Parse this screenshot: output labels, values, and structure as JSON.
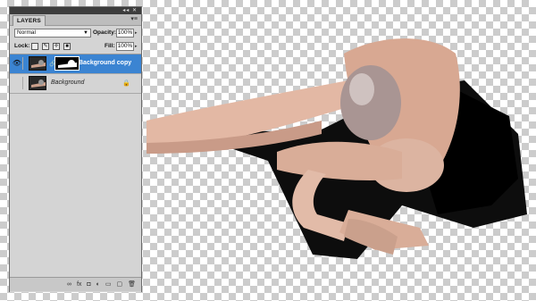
{
  "panel": {
    "tab_label": "LAYERS",
    "blend_mode": "Normal",
    "opacity_label": "Opacity:",
    "opacity_value": "100%",
    "lock_label": "Lock:",
    "fill_label": "Fill:",
    "fill_value": "100%",
    "layers": [
      {
        "name": "Background copy",
        "selected": true,
        "visible": true,
        "has_mask": true
      },
      {
        "name": "Background",
        "selected": false,
        "visible": false,
        "locked": true
      }
    ],
    "bottom_icons": [
      "link-layers-icon",
      "fx-icon",
      "add-mask-icon",
      "adjustment-icon",
      "group-icon",
      "new-layer-icon",
      "delete-icon"
    ],
    "bottom_glyphs": [
      "∞",
      "fx",
      "◘",
      "◐",
      "▭",
      "▢",
      "🗑"
    ]
  },
  "colors": {
    "selected_layer": "#3b84d2",
    "panel_bg": "#d4d4d4",
    "checker_dark": "#cccccc"
  }
}
